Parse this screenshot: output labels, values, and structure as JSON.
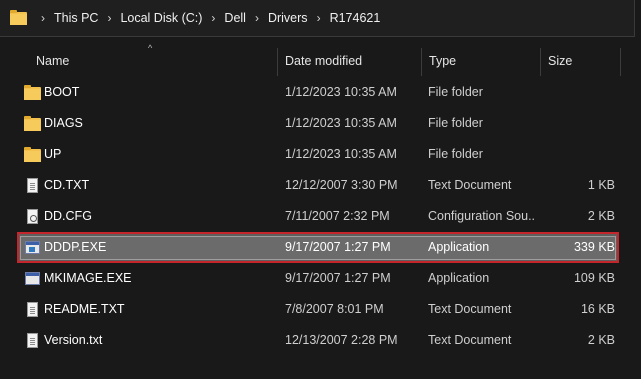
{
  "breadcrumb": [
    "This PC",
    "Local Disk (C:)",
    "Dell",
    "Drivers",
    "R174621"
  ],
  "columns": {
    "name": "Name",
    "date": "Date modified",
    "type": "Type",
    "size": "Size"
  },
  "files": [
    {
      "name": "BOOT",
      "date": "1/12/2023 10:35 AM",
      "type": "File folder",
      "size": "",
      "icon": "folder-icon"
    },
    {
      "name": "DIAGS",
      "date": "1/12/2023 10:35 AM",
      "type": "File folder",
      "size": "",
      "icon": "folder-icon"
    },
    {
      "name": "UP",
      "date": "1/12/2023 10:35 AM",
      "type": "File folder",
      "size": "",
      "icon": "folder-icon"
    },
    {
      "name": "CD.TXT",
      "date": "12/12/2007 3:30 PM",
      "type": "Text Document",
      "size": "1 KB",
      "icon": "text-file-icon"
    },
    {
      "name": "DD.CFG",
      "date": "7/11/2007 2:32 PM",
      "type": "Configuration Sou...",
      "size": "2 KB",
      "icon": "config-file-icon"
    },
    {
      "name": "DDDP.EXE",
      "date": "9/17/2007 1:27 PM",
      "type": "Application",
      "size": "339 KB",
      "icon": "application-icon",
      "selected": true
    },
    {
      "name": "MKIMAGE.EXE",
      "date": "9/17/2007 1:27 PM",
      "type": "Application",
      "size": "109 KB",
      "icon": "application-icon"
    },
    {
      "name": "README.TXT",
      "date": "7/8/2007 8:01 PM",
      "type": "Text Document",
      "size": "16 KB",
      "icon": "text-file-icon"
    },
    {
      "name": "Version.txt",
      "date": "12/13/2007 2:28 PM",
      "type": "Text Document",
      "size": "2 KB",
      "icon": "text-file-icon"
    }
  ],
  "colors": {
    "background": "#191919",
    "highlight_border": "#c4262b",
    "selection": "#5f5f5f"
  }
}
